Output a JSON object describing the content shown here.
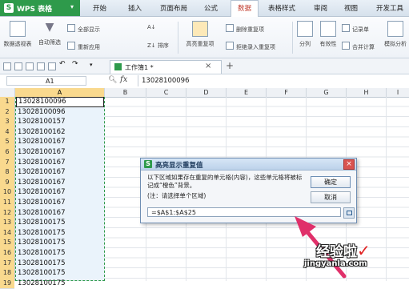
{
  "app": {
    "name": "WPS 表格",
    "logo": "S",
    "accent": "#2e9a4b"
  },
  "menu": [
    "开始",
    "插入",
    "页面布局",
    "公式",
    "数据",
    "表格样式",
    "审阅",
    "视图",
    "开发工具"
  ],
  "menu_active_index": 4,
  "ribbon": {
    "pivot": "数据透视表",
    "autofilter": "自动筛选",
    "show_all": "全部显示",
    "reapply": "重新应用",
    "sort": "排序",
    "highlight_dup": "高亮重复项",
    "remove_dup": "删除重复项",
    "reject_dup": "拒绝录入重复项",
    "split": "分列",
    "validity": "有效性",
    "records": "记录单",
    "merge_calc": "合并计算",
    "simulate": "模拟分析"
  },
  "tabbar": {
    "doc_name": "工作簿1 *",
    "close": "×",
    "new_tab": "+"
  },
  "formula_bar": {
    "cell_ref": "A1",
    "fx_label": "fx",
    "value": "13028100096"
  },
  "columns": [
    "A",
    "B",
    "C",
    "D",
    "E",
    "F",
    "G",
    "H",
    "I"
  ],
  "rows": [
    "1",
    "2",
    "3",
    "4",
    "5",
    "6",
    "7",
    "8",
    "9",
    "10",
    "11",
    "12",
    "13",
    "14",
    "15",
    "16",
    "17",
    "18",
    "19"
  ],
  "column_a": [
    "13028100096",
    "13028100096",
    "13028100157",
    "13028100162",
    "13028100167",
    "13028100167",
    "13028100167",
    "13028100167",
    "13028100167",
    "13028100167",
    "13028100167",
    "13028100167",
    "13028100175",
    "13028100175",
    "13028100175",
    "13028100175",
    "13028100175",
    "13028100175",
    "13028100175"
  ],
  "dialog": {
    "logo": "S",
    "title": "高亮显示重复值",
    "description": "以下区域如果存在重复的单元格(内容)，这些单元格将被标记成“橙色”背景。",
    "note": "(注：请选择单个区域)",
    "ok": "确定",
    "cancel": "取消",
    "range": "=$A$1:$A$25",
    "close": "×"
  },
  "watermark": {
    "line1": "经验啦",
    "check": "✓",
    "line2": "jingyanla.com"
  }
}
